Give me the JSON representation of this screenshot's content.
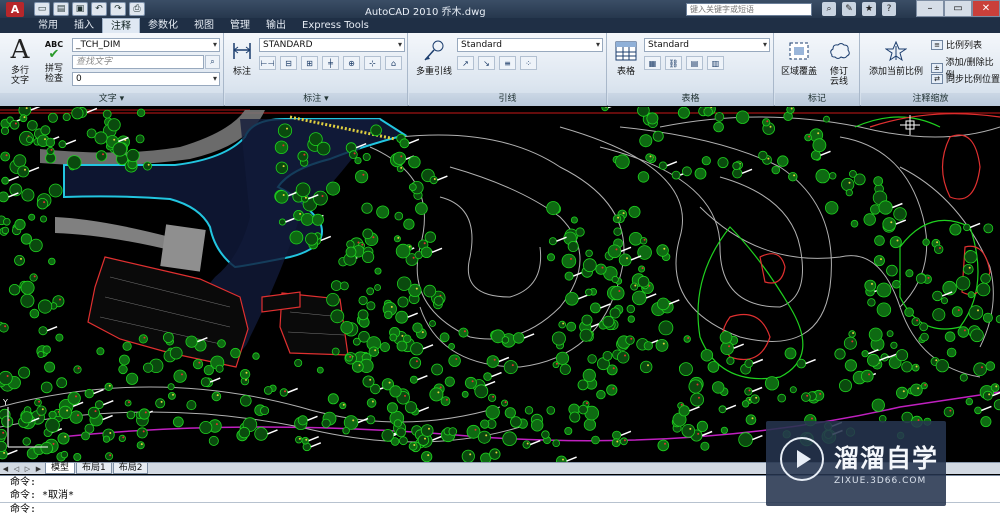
{
  "titlebar": {
    "doc_title": "AutoCAD 2010    乔木.dwg",
    "help_search_placeholder": "键入关键字或短语",
    "logo_letter": "A"
  },
  "ribbon_tabs": [
    "常用",
    "插入",
    "注释",
    "参数化",
    "视图",
    "管理",
    "输出",
    "Express Tools"
  ],
  "active_tab": "注释",
  "panels": {
    "text": {
      "title": "文字 ▾",
      "multiline_label_1": "多行",
      "multiline_label_2": "文字",
      "spell_label_1": "拼写",
      "spell_label_2": "检查",
      "style_value": "_TCH_DIM",
      "find_placeholder": "查找文字",
      "height_value": "0"
    },
    "dimension": {
      "title": "标注 ▾",
      "dim_label": "标注",
      "style_value": "STANDARD"
    },
    "leader": {
      "title": "引线",
      "multileader_label": "多重引线",
      "style_value": "Standard"
    },
    "table": {
      "title": "表格",
      "table_label": "表格",
      "style_value": "Standard"
    },
    "markup": {
      "title": "标记",
      "wipeout_label_1": "区域覆盖",
      "revcloud_label_1": "修订",
      "revcloud_label_2": "云线"
    },
    "annoscale": {
      "title": "注释缩放",
      "add_current_label": "添加当前比例",
      "scale_list": "比例列表",
      "add_delete": "添加/删除比例",
      "sync_position": "同步比例位置"
    }
  },
  "layout_tabs": [
    "模型",
    "布局1",
    "布局2"
  ],
  "command_lines": [
    "命令:",
    "命令: *取消*",
    "命令:"
  ],
  "watermark": {
    "name": "溜溜自学",
    "url": "ZIXUE.3D66.COM"
  },
  "colors": {
    "background": "#000000",
    "tree_green": "#1fd11f",
    "contour_white": "#d0d0d0",
    "water_cyan": "#22c5e0",
    "road_magenta": "#c020c0",
    "building_red": "#e03030"
  }
}
